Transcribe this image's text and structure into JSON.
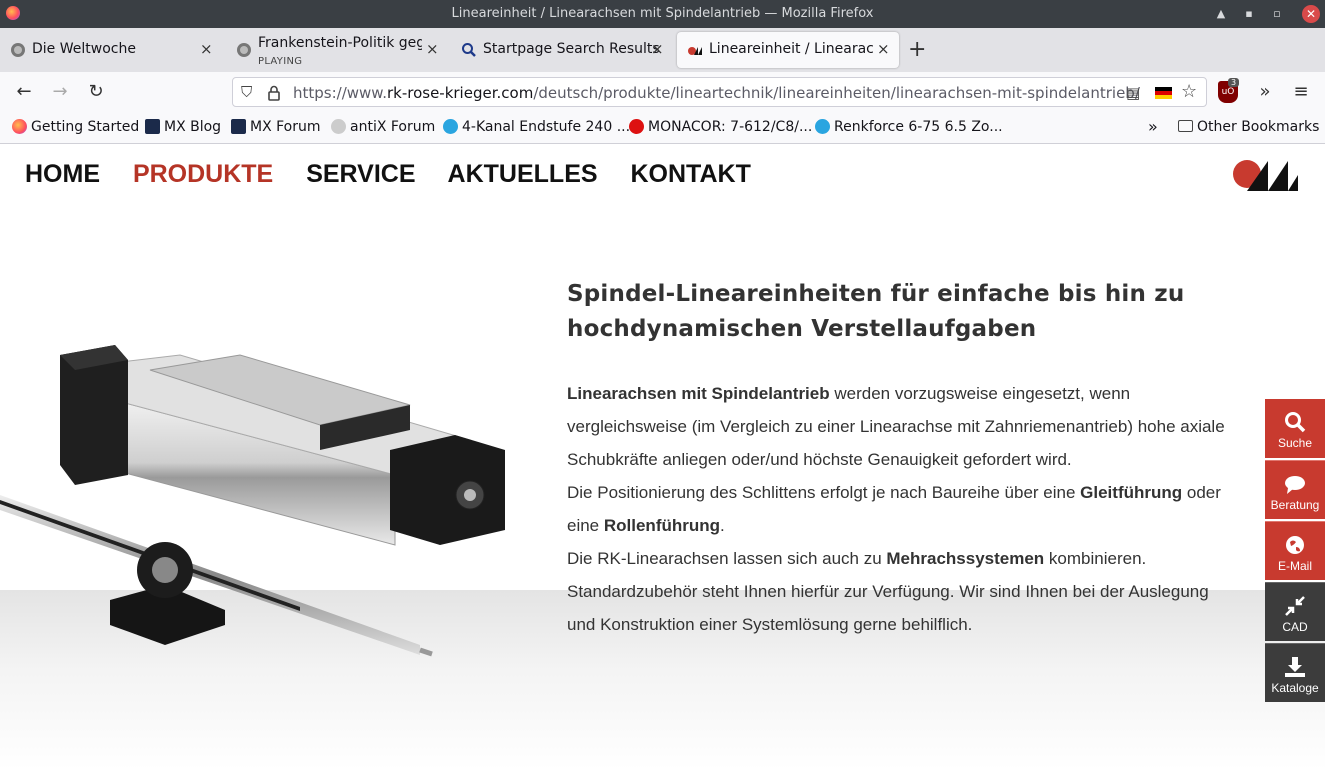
{
  "window": {
    "title": "Lineareinheit / Linearachsen mit Spindelantrieb — Mozilla Firefox"
  },
  "tabs": [
    {
      "label": "Die Weltwoche",
      "sub": ""
    },
    {
      "label": "Frankenstein-Politik geg",
      "sub": "PLAYING"
    },
    {
      "label": "Startpage Search Results",
      "sub": ""
    },
    {
      "label": "Lineareinheit / Linearachs",
      "sub": ""
    }
  ],
  "urlbar": {
    "url_prefix": "https://www.",
    "url_domain": "rk-rose-krieger.com",
    "url_path": "/deutsch/produkte/lineartechnik/lineareinheiten/linearachsen-mit-spindelantrieb/"
  },
  "extension": {
    "badge": "3"
  },
  "bookmarks": [
    "Getting Started",
    "MX Blog",
    "MX Forum",
    "antiX Forum",
    "4-Kanal Endstufe 240 ...",
    "MONACOR: 7-612/C8/...",
    "Renkforce 6-75 6.5 Zo..."
  ],
  "bookmarks_other": "Other Bookmarks",
  "site_nav": [
    "HOME",
    "PRODUKTE",
    "SERVICE",
    "AKTUELLES",
    "KONTAKT"
  ],
  "content": {
    "headline_1": "Spindel-Lineareinheiten für einfache bis hin zu",
    "headline_2": "hochdynamischen Verstellaufgaben",
    "p1_bold": "Linearachsen mit Spindelantrieb",
    "p1_rest": " werden vorzugsweise eingesetzt, wenn vergleichsweise (im Vergleich zu einer Linearachse mit Zahnriemenantrieb) hohe axiale Schubkräfte anliegen oder/und höchste Genauigkeit gefordert wird.",
    "p2_a": "Die Positionierung des Schlittens erfolgt je nach Baureihe über eine ",
    "p2_bold1": "Gleitführung",
    "p2_b": " oder eine ",
    "p2_bold2": "Rollenführung",
    "p2_c": ".",
    "p3_a": "Die RK-Linearachsen lassen sich auch zu ",
    "p3_bold": "Mehrachssystemen",
    "p3_b": " kombinieren. Standardzubehör steht Ihnen hierfür zur Verfügung. Wir sind Ihnen bei der Auslegung und Konstruktion einer Systemlösung gerne behilflich."
  },
  "side_buttons": [
    {
      "label": "Suche",
      "icon": "search-icon"
    },
    {
      "label": "Beratung",
      "icon": "chat-icon"
    },
    {
      "label": "E-Mail",
      "icon": "globe-icon"
    },
    {
      "label": "CAD",
      "icon": "compress-arrows-icon"
    },
    {
      "label": "Kataloge",
      "icon": "download-icon"
    }
  ],
  "colors": {
    "accent_red": "#c83a2f",
    "nav_active": "#b53426",
    "side_dark": "#3c3c3c"
  }
}
